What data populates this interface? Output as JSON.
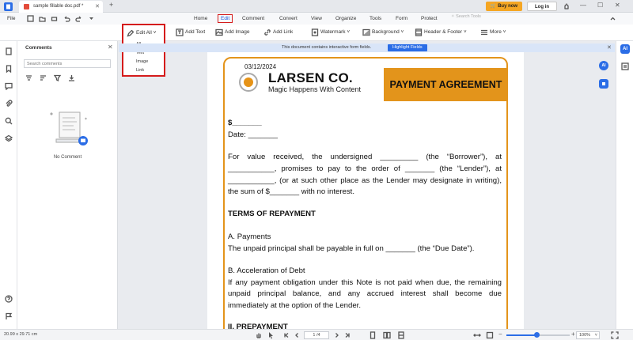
{
  "titlebar": {
    "tab_title": "sample fillable doc.pdf *",
    "buy_now": "Buy now",
    "log_in": "Log in"
  },
  "menubar": {
    "file": "File",
    "items": [
      "Home",
      "Edit",
      "Comment",
      "Convert",
      "View",
      "Organize",
      "Tools",
      "Form",
      "Protect"
    ],
    "search_tools": "Search Tools"
  },
  "toolbar": {
    "edit_all": "Edit All",
    "add_text": "Add Text",
    "add_image": "Add Image",
    "add_link": "Add Link",
    "watermark": "Watermark",
    "background": "Background",
    "header_footer": "Header & Footer",
    "more": "More"
  },
  "edit_dropdown": {
    "options": [
      "All",
      "Text",
      "Image",
      "Link"
    ]
  },
  "comments_panel": {
    "title": "Comments",
    "search_placeholder": "Search comments",
    "empty_text": "No Comment"
  },
  "banner": {
    "text": "This document contains interactive form fields.",
    "button": "Highlight Fields"
  },
  "document": {
    "date": "03/12/2024",
    "company": "LARSEN CO.",
    "tagline": "Magic Happens With Content",
    "header_box": "PAYMENT AGREEMENT",
    "amount_line": "$_______",
    "date_line": "Date: _______",
    "para1_lines": [
      "For value received, the undersigned _________ (the “Borrower”), at",
      "___________, promises to pay to the order of _______ (the “Lender”), at",
      "___________, (or at such other place as the Lender may designate in writing),"
    ],
    "para1_last": "the sum of $_______ with no interest.",
    "terms_heading": "TERMS OF REPAYMENT",
    "a_heading": "A. Payments",
    "a_text": "The unpaid principal shall be payable in full on _______ (the “Due Date”).",
    "b_heading": "B. Acceleration of Debt",
    "b_lines": [
      "If any payment obligation under this Note is not paid when due, the remaining",
      "unpaid principal balance, and any accrued interest shall become due"
    ],
    "b_last": "immediately at the option of the Lender.",
    "next_heading": "II. PREPAYMENT"
  },
  "statusbar": {
    "page_size": "20.99 x 29.71 cm",
    "page_indicator": "1 /4",
    "zoom_level": "100%",
    "zoom_fraction": 0.47
  },
  "colors": {
    "accent_orange": "#e3941b",
    "brand_blue": "#2b6de6",
    "highlight_red": "#d51b1b",
    "buy_now": "#f5a623"
  }
}
